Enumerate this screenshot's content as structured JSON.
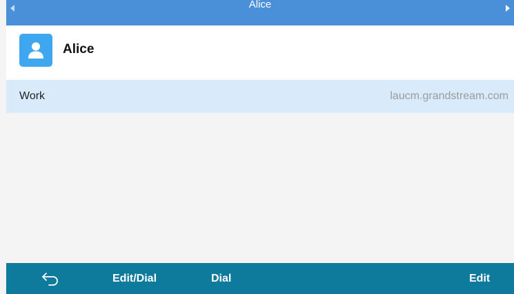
{
  "titlebar": {
    "title": "Alice",
    "left_icon": "arrow-left-icon",
    "right_icon": "arrow-right-icon"
  },
  "contact": {
    "name": "Alice",
    "avatar_icon": "person-icon"
  },
  "details": [
    {
      "label": "Work",
      "value": "laucm.grandstream.com"
    }
  ],
  "softkeys": {
    "back_icon": "back-arrow-icon",
    "edit_dial": "Edit/Dial",
    "dial": "Dial",
    "edit": "Edit"
  },
  "colors": {
    "titlebar": "#4a90d9",
    "avatar": "#3fa7ef",
    "selected_row": "#d9ebfb",
    "softkey_bar": "#0f7b9c",
    "background": "#f4f4f4"
  }
}
